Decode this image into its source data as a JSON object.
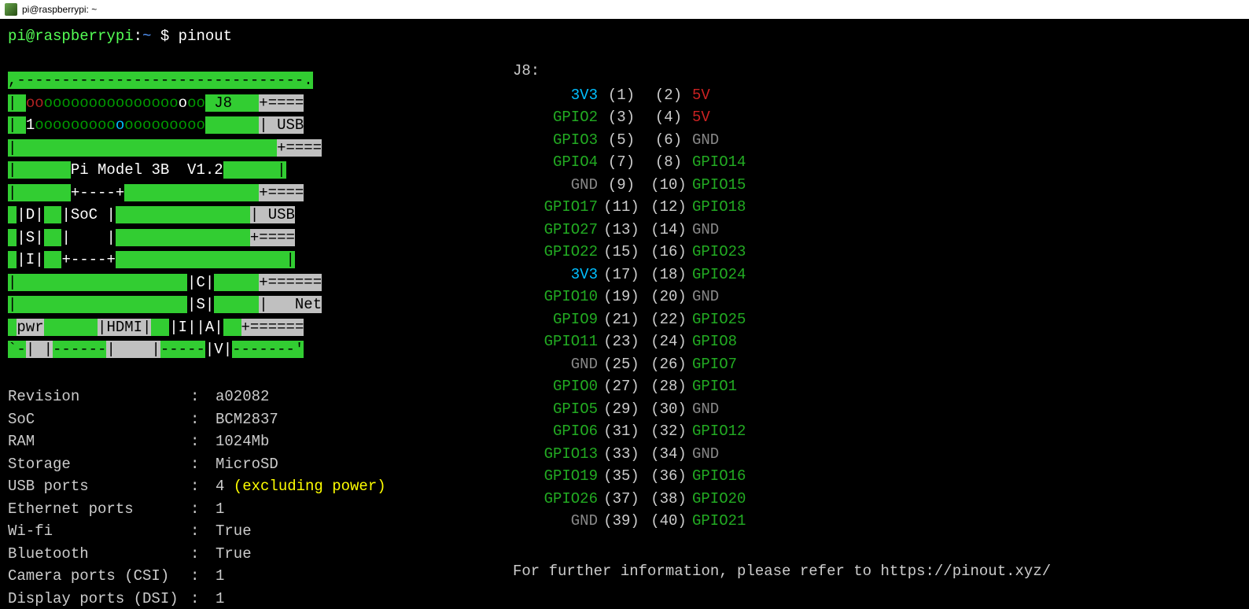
{
  "window": {
    "title": "pi@raspberrypi: ~"
  },
  "prompt": {
    "user_host": "pi@raspberrypi",
    "sep": ":",
    "path": "~",
    "dollar": "$",
    "command": "pinout"
  },
  "board_ascii": {
    "model_line": "Pi Model 3B  V1.2",
    "j8_label": "J8",
    "pwr": "pwr",
    "hdmi": "|HDMI|",
    "usb": "USB",
    "net": "Net",
    "soc": "SoC",
    "dsi": "|D|\n|S|\n|I|",
    "csi": "|C|\n|S|\n|I|",
    "av": "|A|\n|V|"
  },
  "sysinfo": [
    {
      "label": "Revision",
      "value": "a02082"
    },
    {
      "label": "SoC",
      "value": "BCM2837"
    },
    {
      "label": "RAM",
      "value": "1024Mb"
    },
    {
      "label": "Storage",
      "value": "MicroSD"
    },
    {
      "label": "USB ports",
      "value": "4",
      "note": "(excluding power)"
    },
    {
      "label": "Ethernet ports",
      "value": "1"
    },
    {
      "label": "Wi-fi",
      "value": "True"
    },
    {
      "label": "Bluetooth",
      "value": "True"
    },
    {
      "label": "Camera ports (CSI)",
      "value": "1"
    },
    {
      "label": "Display ports (DSI)",
      "value": "1"
    }
  ],
  "pins": {
    "header": "J8:",
    "rows": [
      {
        "l": "3V3",
        "lc": "c-3v3",
        "n1": "(1)",
        "n2": "(2)",
        "r": "5V",
        "rc": "c-5v"
      },
      {
        "l": "GPIO2",
        "lc": "c-gpio",
        "n1": "(3)",
        "n2": "(4)",
        "r": "5V",
        "rc": "c-5v"
      },
      {
        "l": "GPIO3",
        "lc": "c-gpio",
        "n1": "(5)",
        "n2": "(6)",
        "r": "GND",
        "rc": "c-gnd"
      },
      {
        "l": "GPIO4",
        "lc": "c-gpio",
        "n1": "(7)",
        "n2": "(8)",
        "r": "GPIO14",
        "rc": "c-gpio"
      },
      {
        "l": "GND",
        "lc": "c-gnd",
        "n1": "(9)",
        "n2": "(10)",
        "r": "GPIO15",
        "rc": "c-gpio"
      },
      {
        "l": "GPIO17",
        "lc": "c-gpio",
        "n1": "(11)",
        "n2": "(12)",
        "r": "GPIO18",
        "rc": "c-gpio"
      },
      {
        "l": "GPIO27",
        "lc": "c-gpio",
        "n1": "(13)",
        "n2": "(14)",
        "r": "GND",
        "rc": "c-gnd"
      },
      {
        "l": "GPIO22",
        "lc": "c-gpio",
        "n1": "(15)",
        "n2": "(16)",
        "r": "GPIO23",
        "rc": "c-gpio"
      },
      {
        "l": "3V3",
        "lc": "c-3v3",
        "n1": "(17)",
        "n2": "(18)",
        "r": "GPIO24",
        "rc": "c-gpio"
      },
      {
        "l": "GPIO10",
        "lc": "c-gpio",
        "n1": "(19)",
        "n2": "(20)",
        "r": "GND",
        "rc": "c-gnd"
      },
      {
        "l": "GPIO9",
        "lc": "c-gpio",
        "n1": "(21)",
        "n2": "(22)",
        "r": "GPIO25",
        "rc": "c-gpio"
      },
      {
        "l": "GPIO11",
        "lc": "c-gpio",
        "n1": "(23)",
        "n2": "(24)",
        "r": "GPIO8",
        "rc": "c-gpio"
      },
      {
        "l": "GND",
        "lc": "c-gnd",
        "n1": "(25)",
        "n2": "(26)",
        "r": "GPIO7",
        "rc": "c-gpio"
      },
      {
        "l": "GPIO0",
        "lc": "c-gpio",
        "n1": "(27)",
        "n2": "(28)",
        "r": "GPIO1",
        "rc": "c-gpio"
      },
      {
        "l": "GPIO5",
        "lc": "c-gpio",
        "n1": "(29)",
        "n2": "(30)",
        "r": "GND",
        "rc": "c-gnd"
      },
      {
        "l": "GPIO6",
        "lc": "c-gpio",
        "n1": "(31)",
        "n2": "(32)",
        "r": "GPIO12",
        "rc": "c-gpio"
      },
      {
        "l": "GPIO13",
        "lc": "c-gpio",
        "n1": "(33)",
        "n2": "(34)",
        "r": "GND",
        "rc": "c-gnd"
      },
      {
        "l": "GPIO19",
        "lc": "c-gpio",
        "n1": "(35)",
        "n2": "(36)",
        "r": "GPIO16",
        "rc": "c-gpio"
      },
      {
        "l": "GPIO26",
        "lc": "c-gpio",
        "n1": "(37)",
        "n2": "(38)",
        "r": "GPIO20",
        "rc": "c-gpio"
      },
      {
        "l": "GND",
        "lc": "c-gnd",
        "n1": "(39)",
        "n2": "(40)",
        "r": "GPIO21",
        "rc": "c-gpio"
      }
    ]
  },
  "footer": {
    "text": "For further information, please refer to ",
    "link": "https://pinout.xyz/"
  }
}
